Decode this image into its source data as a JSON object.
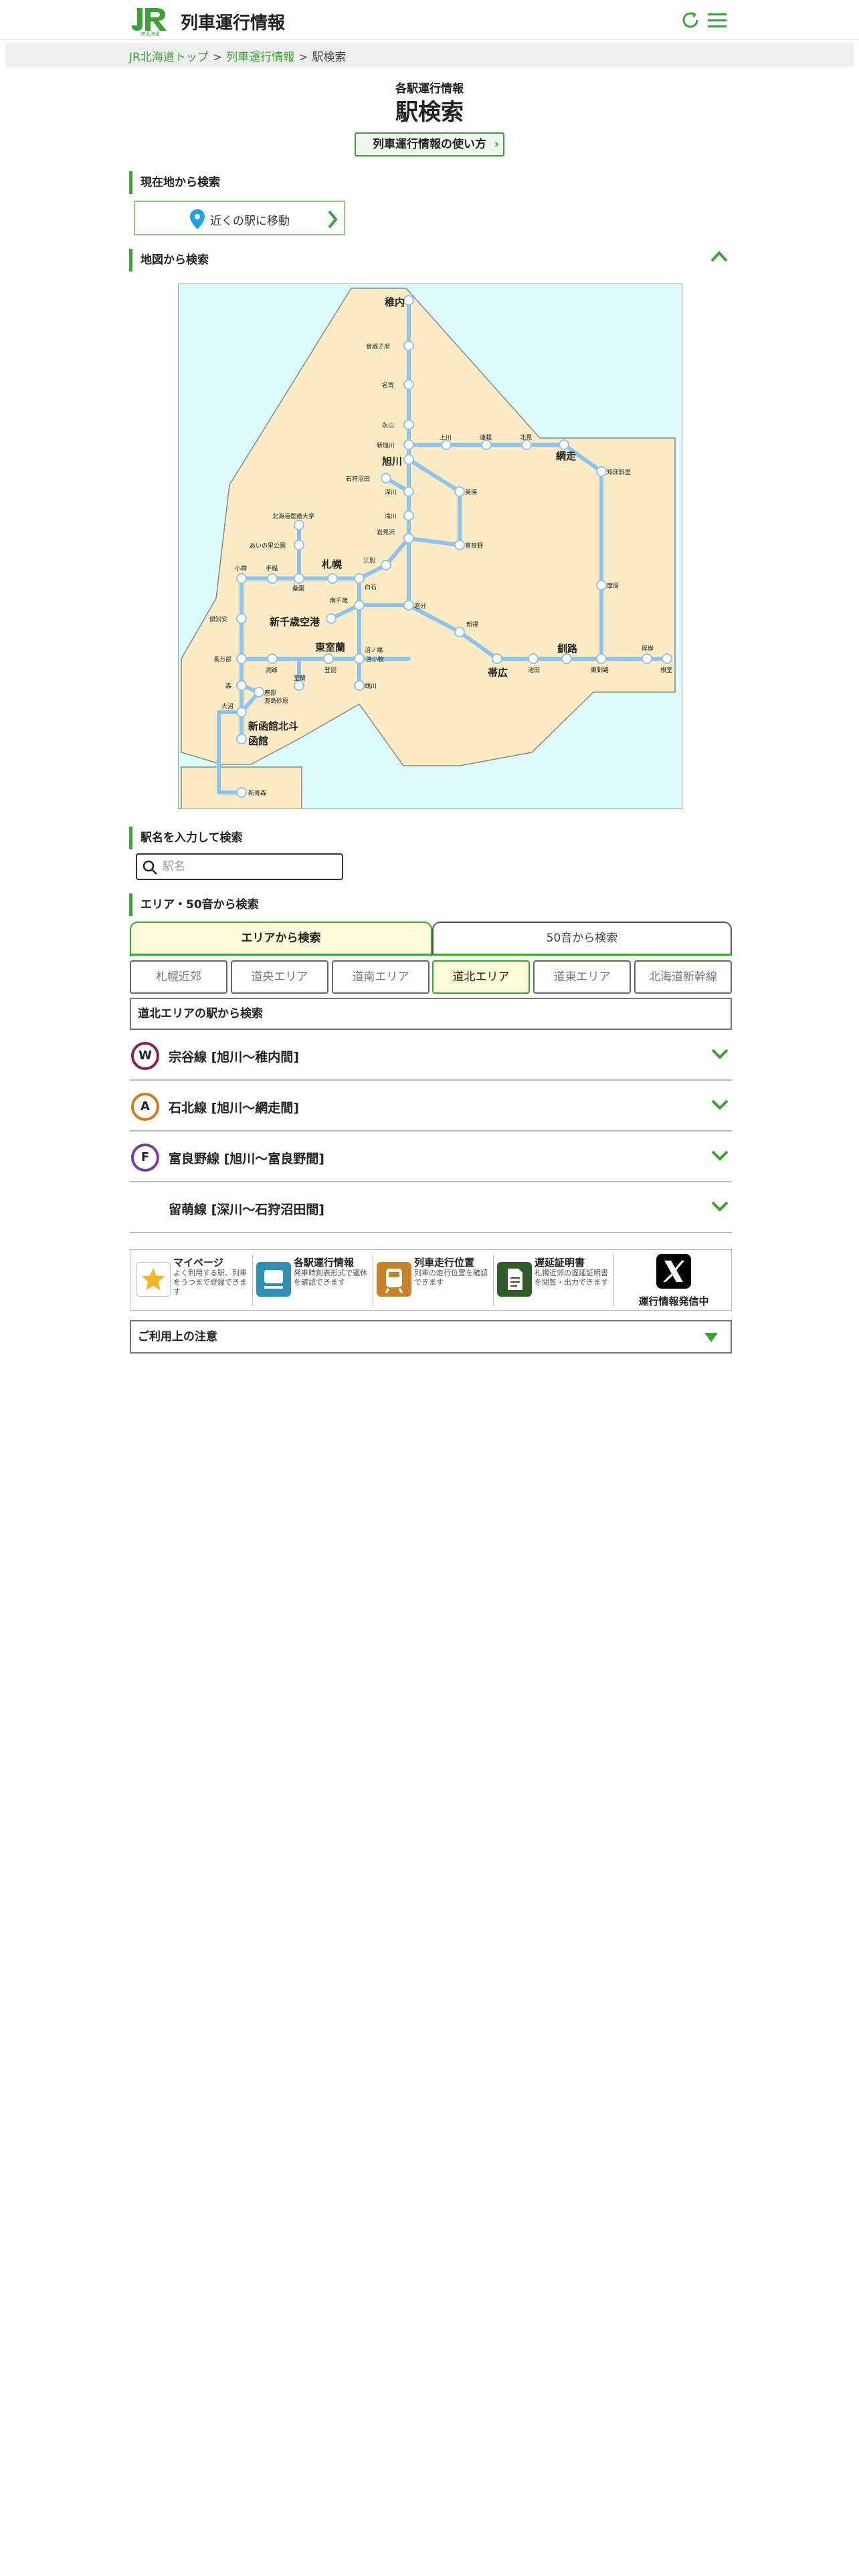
{
  "header": {
    "logo_text": "JR北海道",
    "title": "列車運行情報"
  },
  "breadcrumb": {
    "home": "JR北海道トップ",
    "parent": "列車運行情報",
    "current": "駅検索"
  },
  "page": {
    "subtitle": "各駅運行情報",
    "title": "駅検索",
    "howto_label": "列車運行情報の使い方"
  },
  "location_search": {
    "heading": "現在地から検索",
    "nearby_label": "近くの駅に移動"
  },
  "map_search": {
    "heading": "地図から検索",
    "stations": [
      {
        "name": "稚内"
      },
      {
        "name": "音威子府"
      },
      {
        "name": "名寄"
      },
      {
        "name": "永山"
      },
      {
        "name": "新旭川"
      },
      {
        "name": "旭川"
      },
      {
        "name": "上川"
      },
      {
        "name": "遠軽"
      },
      {
        "name": "北見"
      },
      {
        "name": "網走"
      },
      {
        "name": "知床斜里"
      },
      {
        "name": "石狩沼田"
      },
      {
        "name": "深川"
      },
      {
        "name": "美瑛"
      },
      {
        "name": "滝川"
      },
      {
        "name": "富良野"
      },
      {
        "name": "岩見沢"
      },
      {
        "name": "江別"
      },
      {
        "name": "北海道医療大学"
      },
      {
        "name": "あいの里公園"
      },
      {
        "name": "小樽"
      },
      {
        "name": "手稲"
      },
      {
        "name": "札幌"
      },
      {
        "name": "桑園"
      },
      {
        "name": "白石"
      },
      {
        "name": "南千歳"
      },
      {
        "name": "新千歳空港"
      },
      {
        "name": "倶知安"
      },
      {
        "name": "追分"
      },
      {
        "name": "新得"
      },
      {
        "name": "帯広"
      },
      {
        "name": "池田"
      },
      {
        "name": "釧路"
      },
      {
        "name": "東釧路"
      },
      {
        "name": "厚岸"
      },
      {
        "name": "根室"
      },
      {
        "name": "摩周"
      },
      {
        "name": "東室蘭"
      },
      {
        "name": "長万部"
      },
      {
        "name": "洞爺"
      },
      {
        "name": "室蘭"
      },
      {
        "name": "登別"
      },
      {
        "name": "沼ノ端"
      },
      {
        "name": "苫小牧"
      },
      {
        "name": "鵡川"
      },
      {
        "name": "森"
      },
      {
        "name": "鹿部"
      },
      {
        "name": "渡島砂原"
      },
      {
        "name": "大沼"
      },
      {
        "name": "新函館北斗"
      },
      {
        "name": "函館"
      },
      {
        "name": "新青森"
      }
    ]
  },
  "name_search": {
    "heading": "駅名を入力して検索",
    "placeholder": "駅名"
  },
  "area_search": {
    "heading": "エリア・50音から検索",
    "tabs": [
      "エリアから検索",
      "50音から検索"
    ],
    "areas": [
      "札幌近郊",
      "道央エリア",
      "道南エリア",
      "道北エリア",
      "道東エリア",
      "北海道新幹線"
    ],
    "active_area": "道北エリア",
    "section_title": "道北エリアの駅から検索",
    "lines": [
      {
        "badge": "W",
        "name": "宗谷線 [旭川〜稚内間]",
        "color": "#8e1f4a"
      },
      {
        "badge": "A",
        "name": "石北線 [旭川〜網走間]",
        "color": "#d57a1e"
      },
      {
        "badge": "F",
        "name": "富良野線 [旭川〜富良野間]",
        "color": "#7a3ba6"
      },
      {
        "badge": "",
        "name": "留萌線 [深川〜石狩沼田間]",
        "color": "#ffffff"
      }
    ]
  },
  "services": [
    {
      "title": "マイページ",
      "desc": "よく利用する駅、列車をうつまで登録できます",
      "icon": "star-icon"
    },
    {
      "title": "各駅運行情報",
      "desc": "発車時刻表形式で運休を確認できます",
      "icon": "timetable-icon"
    },
    {
      "title": "列車走行位置",
      "desc": "列車の走行位置を確認できます",
      "icon": "train-icon"
    },
    {
      "title": "遅延証明書",
      "desc": "札幌近郊の遅延証明書を閲覧・出力できます",
      "icon": "document-icon"
    },
    {
      "title": "運行情報発信中",
      "desc": "",
      "icon": "x-logo-icon"
    }
  ],
  "notice": {
    "label": "ご利用上の注意"
  }
}
